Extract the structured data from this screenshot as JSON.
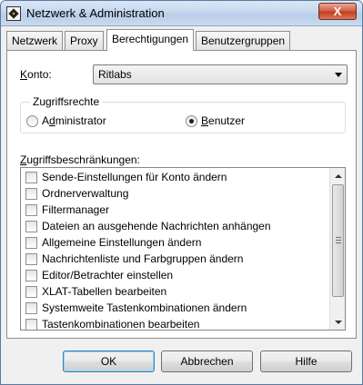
{
  "window": {
    "title": "Netzwerk & Administration",
    "close_label": "X"
  },
  "tabs": [
    {
      "label": "Netzwerk"
    },
    {
      "label": "Proxy"
    },
    {
      "label": "Berechtigungen",
      "active": true
    },
    {
      "label": "Benutzergruppen"
    }
  ],
  "account": {
    "label_hotkey": "K",
    "label_rest": "onto:",
    "value": "Ritlabs"
  },
  "access_rights": {
    "title": "Zugriffsrechte",
    "admin": {
      "hotkey": "d",
      "before": "A",
      "after": "ministrator",
      "checked": false
    },
    "user": {
      "hotkey": "B",
      "before": "",
      "after": "enutzer",
      "checked": true
    }
  },
  "restrictions": {
    "label_hotkey": "Z",
    "label_rest": "ugriffsbeschränkungen:",
    "items": [
      "Sende-Einstellungen für Konto ändern",
      "Ordnerverwaltung",
      "Filtermanager",
      "Dateien an ausgehende Nachrichten anhängen",
      "Allgemeine Einstellungen ändern",
      "Nachrichtenliste und Farbgruppen ändern",
      "Editor/Betrachter einstellen",
      "XLAT-Tabellen bearbeiten",
      "Systemweite Tastenkombinationen ändern",
      "Tastenkombinationen bearbeiten"
    ]
  },
  "buttons": {
    "ok": "OK",
    "cancel": "Abbrechen",
    "help": "Hilfe"
  }
}
